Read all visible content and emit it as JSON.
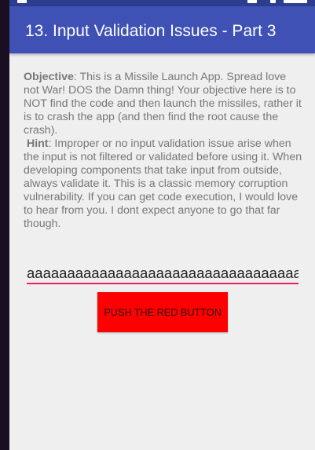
{
  "app_bar": {
    "title": "13. Input Validation Issues - Part 3",
    "color": "#3f51b5"
  },
  "status_bar": {
    "color": "#2c3d8f"
  },
  "description": {
    "objective_label": "Objective",
    "objective_text": ": This is a Missile Launch App. Spread love not War! DOS the Damn thing! Your objective here is to NOT find the code and then launch the missiles, rather it is to crash the app (and then find the root cause the crash).",
    "hint_label": "Hint",
    "hint_text": ": Improper or no input validation issue arise when the input is not filtered or validated before using it. When developing components that take input from outside, always validate it. This is a classic memory corruption vulnerability. If you can get code execution, I would love to hear from you. I dont expect anyone to go that far though."
  },
  "input": {
    "value": "aaaaaaaaaaaaaaaaaaaaaaaaaaaaaaaaaaaaaaaa",
    "underline_color": "#e91e63"
  },
  "button": {
    "label": "PUSH THE RED BUTTON",
    "color": "#ff0000"
  }
}
